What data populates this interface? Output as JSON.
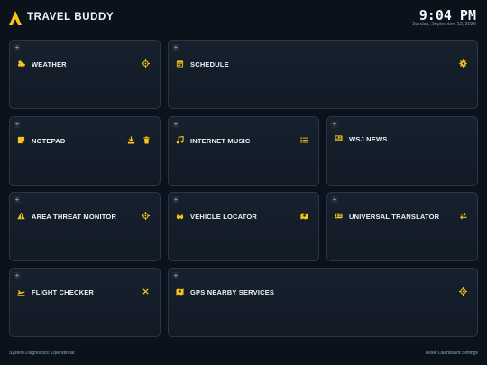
{
  "header": {
    "title": "TRAVEL BUDDY",
    "time": "9:04 PM",
    "date": "Sunday, September 13, 2026"
  },
  "colors": {
    "accent": "#f5c518",
    "background": "#0b121b",
    "card": "#151f2b"
  },
  "cards": {
    "weather": {
      "title": "WEATHER",
      "icon": "weather-partly-cloudy-icon",
      "action_icon": "crosshair-icon"
    },
    "schedule": {
      "title": "SCHEDULE",
      "icon": "calendar-icon",
      "action_icon": "gear-icon"
    },
    "notepad": {
      "title": "NOTEPAD",
      "icon": "note-icon",
      "action_icons": [
        "download-icon",
        "trash-icon"
      ]
    },
    "music": {
      "title": "INTERNET MUSIC",
      "icon": "music-note-icon",
      "action_icon": "list-icon"
    },
    "news": {
      "title": "WSJ NEWS",
      "icon": "newspaper-icon"
    },
    "threat": {
      "title": "AREA THREAT MONITOR",
      "icon": "warning-icon",
      "action_icon": "crosshair-icon"
    },
    "vehicle": {
      "title": "VEHICLE LOCATOR",
      "icon": "car-icon",
      "action_icon": "map-icon"
    },
    "translator": {
      "title": "UNIVERSAL TRANSLATOR",
      "icon": "id-card-icon",
      "action_icon": "swap-icon"
    },
    "flight": {
      "title": "FLIGHT CHECKER",
      "icon": "plane-icon",
      "action_icon": "close-icon"
    },
    "gps": {
      "title": "GPS NEARBY SERVICES",
      "icon": "map-icon",
      "action_icon": "crosshair-icon"
    }
  },
  "add_symbol": "+",
  "footer": {
    "status": "System Diagnostics: Operational",
    "reset": "Reset Dashboard Settings"
  }
}
